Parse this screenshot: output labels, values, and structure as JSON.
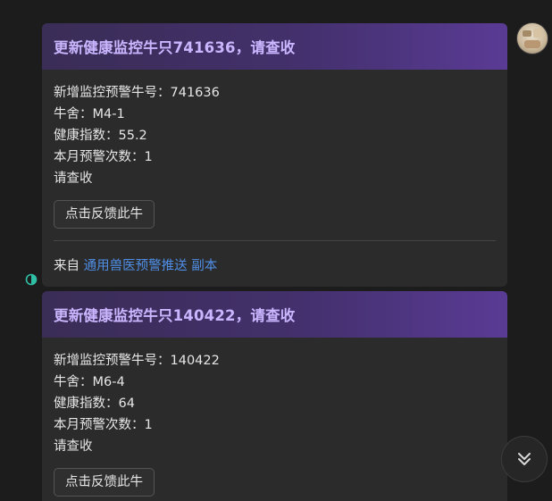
{
  "messages": [
    {
      "title": "更新健康监控牛只741636，请查收",
      "lines": [
        "新增监控预警牛号：741636",
        "牛舍：M4-1",
        "健康指数：55.2",
        "本月预警次数：1",
        "请查收"
      ],
      "button_label": "点击反馈此牛",
      "source_prefix": "来自",
      "source_link": "通用兽医预警推送 副本"
    },
    {
      "title": "更新健康监控牛只140422，请查收",
      "lines": [
        "新增监控预警牛号：140422",
        "牛舍：M6-4",
        "健康指数：64",
        "本月预警次数：1",
        "请查收"
      ],
      "button_label": "点击反馈此牛"
    }
  ],
  "icons": {
    "avatar": "avatar-image",
    "status": "status-circle-icon",
    "scroll": "double-chevron-down-icon"
  },
  "colors": {
    "header_text": "#c9b6ff",
    "link": "#4f8ee6",
    "status_icon": "#2fbfa6"
  }
}
